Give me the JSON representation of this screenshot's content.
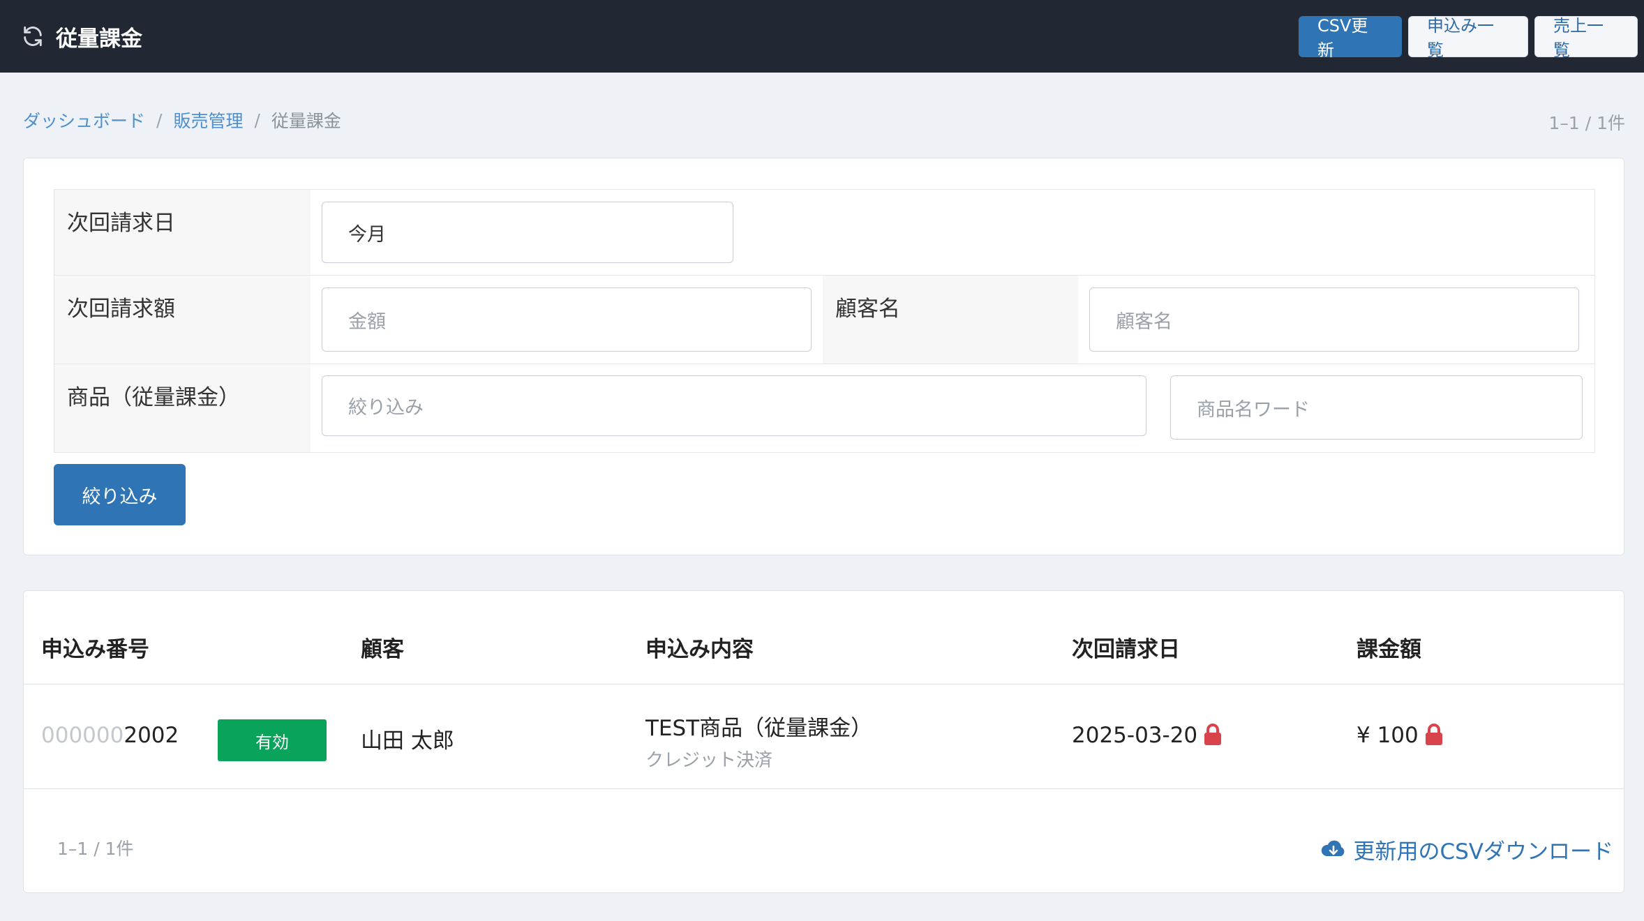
{
  "header": {
    "title": "従量課金",
    "buttons": {
      "csv_update": "CSV更新",
      "applications": "申込み一覧",
      "sales": "売上一覧"
    }
  },
  "breadcrumb": {
    "items": [
      "ダッシュボード",
      "販売管理",
      "従量課金"
    ],
    "separator": "/"
  },
  "pagination": {
    "range": "1–1 / 1件"
  },
  "filters": {
    "next_billing_date": {
      "label": "次回請求日",
      "value": "今月"
    },
    "next_billing_amount": {
      "label": "次回請求額",
      "placeholder": "金額"
    },
    "customer_name": {
      "label": "顧客名",
      "placeholder": "顧客名"
    },
    "product": {
      "label": "商品（従量課金）",
      "select_placeholder": "絞り込み",
      "word_placeholder": "商品名ワード"
    },
    "submit_label": "絞り込み"
  },
  "table": {
    "columns": [
      "申込み番号",
      "顧客",
      "申込み内容",
      "次回請求日",
      "課金額"
    ],
    "rows": [
      {
        "order_prefix": "000000",
        "order_suffix": "2002",
        "status": "有効",
        "customer": "山田 太郎",
        "product": "TEST商品（従量課金）",
        "payment": "クレジット決済",
        "next_billing_date": "2025-03-20",
        "amount": "¥ 100"
      }
    ]
  },
  "footer": {
    "count": "1–1 / 1件",
    "download_label": "更新用のCSVダウンロード"
  },
  "colors": {
    "header_bg": "#212733",
    "primary": "#2f74b5",
    "status_active": "#0aa35b",
    "lock": "#d9434b"
  }
}
